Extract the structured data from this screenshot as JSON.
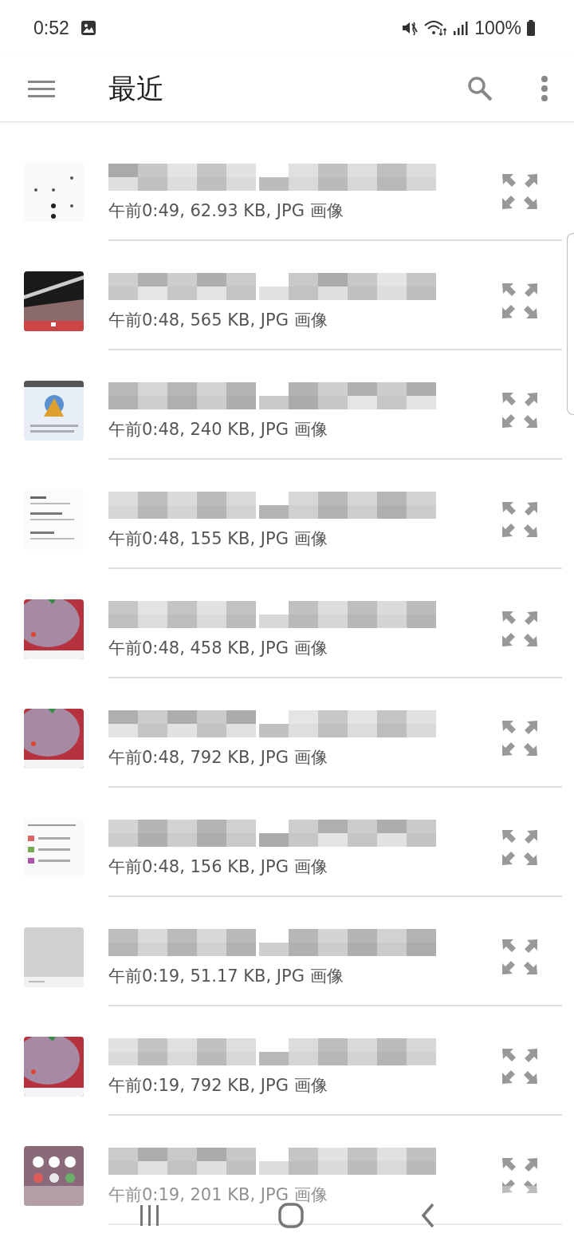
{
  "status_bar": {
    "time": "0:52",
    "battery": "100%"
  },
  "app_bar": {
    "title": "最近"
  },
  "files": [
    {
      "meta": "午前0:49, 62.93 KB, JPG 画像"
    },
    {
      "meta": "午前0:48, 565 KB, JPG 画像"
    },
    {
      "meta": "午前0:48, 240 KB, JPG 画像"
    },
    {
      "meta": "午前0:48, 155 KB, JPG 画像"
    },
    {
      "meta": "午前0:48, 458 KB, JPG 画像"
    },
    {
      "meta": "午前0:48, 792 KB, JPG 画像"
    },
    {
      "meta": "午前0:48, 156 KB, JPG 画像"
    },
    {
      "meta": "午前0:19, 51.17 KB, JPG 画像"
    },
    {
      "meta": "午前0:19, 792 KB, JPG 画像"
    },
    {
      "meta": "午前0:19, 201 KB, JPG 画像"
    }
  ]
}
